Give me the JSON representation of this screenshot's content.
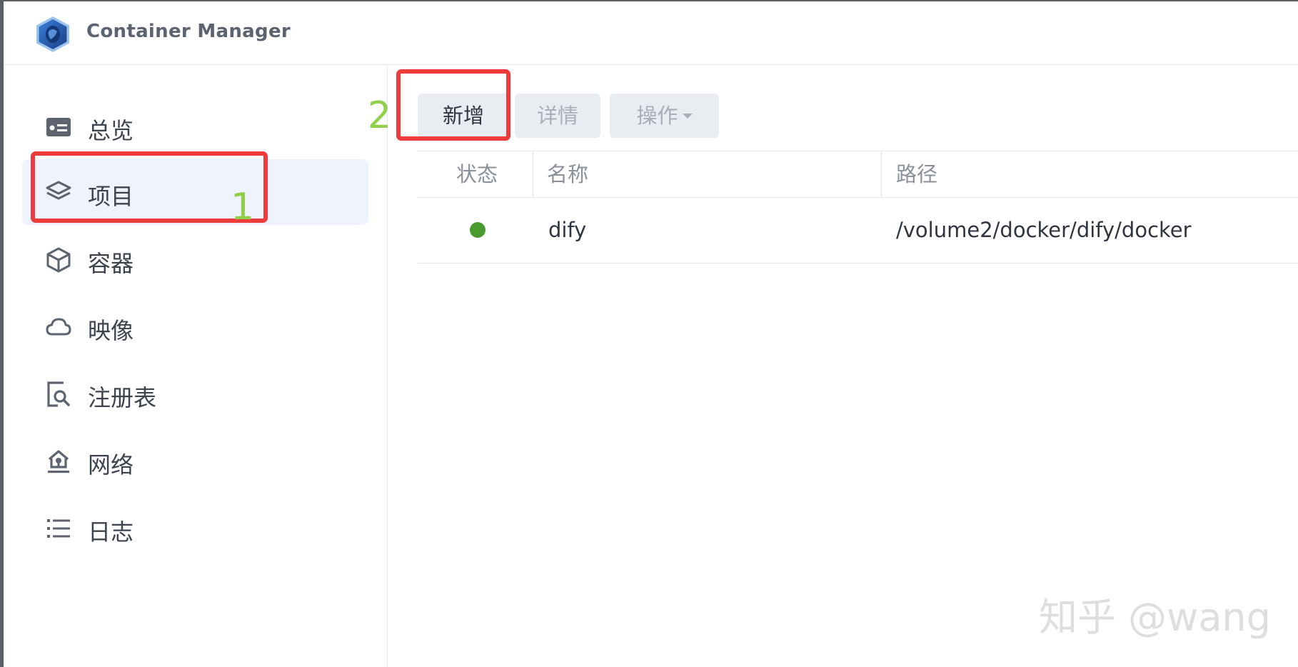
{
  "app": {
    "title": "Container Manager",
    "logo_icon": "container-manager-hex-icon"
  },
  "sidebar": {
    "items": [
      {
        "label": "总览",
        "icon": "overview-card-icon",
        "active": false
      },
      {
        "label": "项目",
        "icon": "layers-icon",
        "active": true
      },
      {
        "label": "容器",
        "icon": "cube-icon",
        "active": false
      },
      {
        "label": "映像",
        "icon": "cloud-icon",
        "active": false
      },
      {
        "label": "注册表",
        "icon": "registry-search-icon",
        "active": false
      },
      {
        "label": "网络",
        "icon": "network-home-icon",
        "active": false
      },
      {
        "label": "日志",
        "icon": "list-icon",
        "active": false
      }
    ]
  },
  "toolbar": {
    "add_label": "新增",
    "details_label": "详情",
    "actions_label": "操作"
  },
  "table": {
    "headers": {
      "status": "状态",
      "name": "名称",
      "path": "路径"
    },
    "rows": [
      {
        "status_color": "#4a9a2e",
        "name": "dify",
        "path": "/volume2/docker/dify/docker"
      }
    ]
  },
  "annotations": {
    "step1": "1",
    "step2": "2",
    "box_color": "#ee3b3b",
    "number_color": "#8fcf4a"
  },
  "watermark": "知乎 @wang",
  "colors": {
    "active_nav_bg": "#eef3fd",
    "button_bg": "#e9ecf0",
    "border": "#e3e7ec"
  }
}
